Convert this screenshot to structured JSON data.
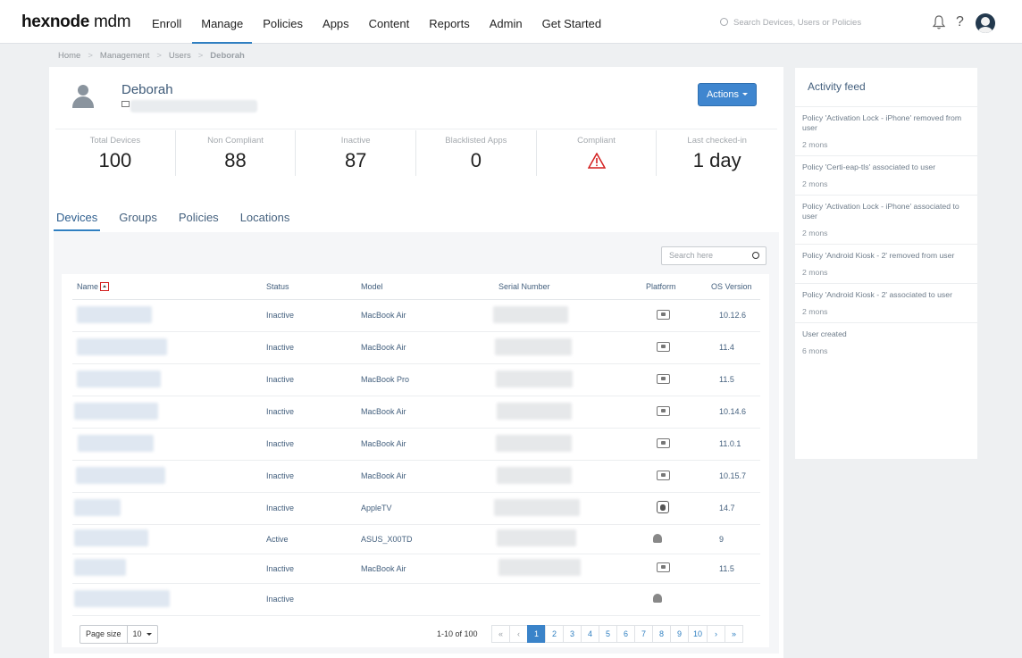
{
  "brand": {
    "bold": "hexnode",
    "light": " mdm"
  },
  "nav": {
    "items": [
      "Enroll",
      "Manage",
      "Policies",
      "Apps",
      "Content",
      "Reports",
      "Admin",
      "Get Started"
    ],
    "active": "Manage",
    "search_placeholder": "Search Devices, Users or Policies",
    "help": "?"
  },
  "breadcrumb": [
    "Home",
    "Management",
    "Users",
    "Deborah"
  ],
  "user": {
    "name": "Deborah",
    "actions_label": "Actions"
  },
  "stats": [
    {
      "label": "Total Devices",
      "value": "100"
    },
    {
      "label": "Non Compliant",
      "value": "88"
    },
    {
      "label": "Inactive",
      "value": "87"
    },
    {
      "label": "Blacklisted Apps",
      "value": "0"
    },
    {
      "label": "Compliant",
      "value": ""
    },
    {
      "label": "Last checked-in",
      "value": "1 day"
    }
  ],
  "tabs": [
    "Devices",
    "Groups",
    "Policies",
    "Locations"
  ],
  "table": {
    "search_placeholder": "Search here",
    "columns": [
      "Name",
      "Status",
      "Model",
      "Serial Number",
      "Platform",
      "OS Version"
    ],
    "rows": [
      {
        "status": "Inactive",
        "model": "MacBook Air",
        "platform": "mac",
        "os": "10.12.6"
      },
      {
        "status": "Inactive",
        "model": "MacBook Air",
        "platform": "mac",
        "os": "11.4"
      },
      {
        "status": "Inactive",
        "model": "MacBook Pro",
        "platform": "mac",
        "os": "11.5"
      },
      {
        "status": "Inactive",
        "model": "MacBook Air",
        "platform": "mac",
        "os": "10.14.6"
      },
      {
        "status": "Inactive",
        "model": "MacBook Air",
        "platform": "mac",
        "os": "11.0.1"
      },
      {
        "status": "Inactive",
        "model": "MacBook Air",
        "platform": "mac",
        "os": "10.15.7"
      },
      {
        "status": "Inactive",
        "model": "AppleTV",
        "platform": "apple",
        "os": "14.7"
      },
      {
        "status": "Active",
        "model": "ASUS_X00TD",
        "platform": "android",
        "os": "9"
      },
      {
        "status": "Inactive",
        "model": "MacBook Air",
        "platform": "mac",
        "os": "11.5"
      },
      {
        "status": "Inactive",
        "model": "",
        "platform": "android",
        "os": ""
      }
    ]
  },
  "pagination": {
    "page_size_label": "Page size",
    "page_size": "10",
    "range": "1-10 of 100",
    "buttons": [
      "«",
      "‹",
      "1",
      "2",
      "3",
      "4",
      "5",
      "6",
      "7",
      "8",
      "9",
      "10",
      "›",
      "»"
    ],
    "current": "1"
  },
  "activity_feed": {
    "title": "Activity feed",
    "items": [
      {
        "text": "Policy 'Activation Lock - iPhone' removed from user",
        "time": "2 mons"
      },
      {
        "text": "Policy 'Certi-eap-tls' associated to user",
        "time": "2 mons"
      },
      {
        "text": "Policy 'Activation Lock - iPhone' associated to user",
        "time": "2 mons"
      },
      {
        "text": "Policy 'Android Kiosk - 2' removed from user",
        "time": "2 mons"
      },
      {
        "text": "Policy 'Android Kiosk - 2' associated to user",
        "time": "2 mons"
      },
      {
        "text": "User created",
        "time": "6 mons"
      }
    ]
  },
  "colors": {
    "accent": "#3f86cf",
    "warning": "#d32020"
  }
}
